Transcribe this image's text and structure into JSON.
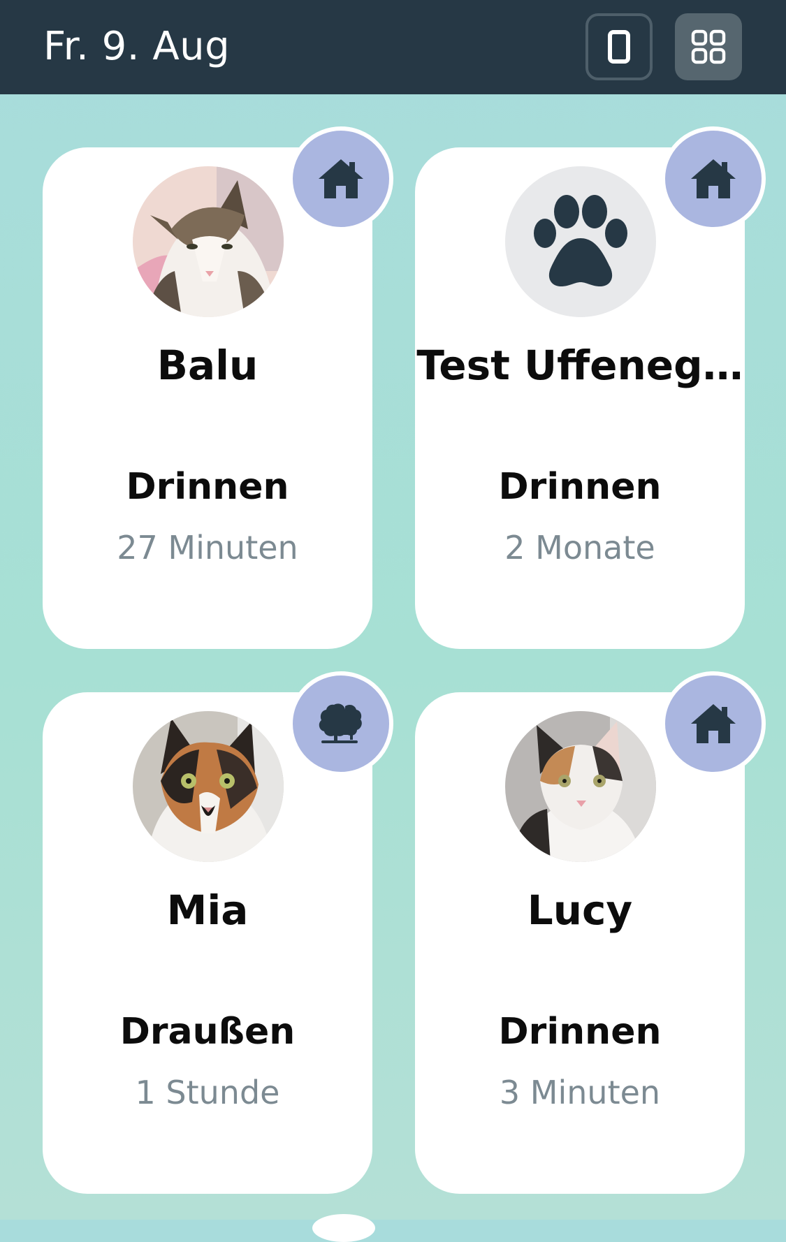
{
  "header": {
    "date": "Fr. 9. Aug",
    "single_view_icon": "phone-outline-icon",
    "grid_view_icon": "grid-four-icon"
  },
  "colors": {
    "header_bg": "#263845",
    "badge_bg": "#aab6e0",
    "icon_dark": "#263845",
    "duration_text": "#7c8a92"
  },
  "pets": [
    {
      "name": "Balu",
      "location": "Drinnen",
      "duration": "27 Minuten",
      "status_icon": "house-icon",
      "avatar": "cat-photo"
    },
    {
      "name": "Test Uffeneg…",
      "location": "Drinnen",
      "duration": "2 Monate",
      "status_icon": "house-icon",
      "avatar": "paw-placeholder-icon"
    },
    {
      "name": "Mia",
      "location": "Draußen",
      "duration": "1 Stunde",
      "status_icon": "trees-icon",
      "avatar": "cat-photo"
    },
    {
      "name": "Lucy",
      "location": "Drinnen",
      "duration": "3 Minuten",
      "status_icon": "house-icon",
      "avatar": "cat-photo"
    }
  ]
}
